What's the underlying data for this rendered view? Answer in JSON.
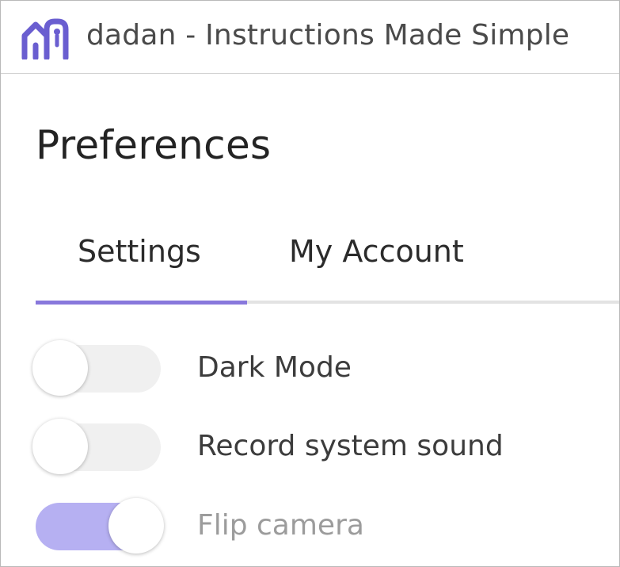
{
  "window": {
    "title": "dadan - Instructions Made Simple",
    "logo_icon": "dadan-logo-icon",
    "accent_color": "#8878dc"
  },
  "page": {
    "title": "Preferences"
  },
  "tabs": [
    {
      "label": "Settings",
      "active": true
    },
    {
      "label": "My Account",
      "active": false
    }
  ],
  "settings": [
    {
      "label": "Dark Mode",
      "enabled": false
    },
    {
      "label": "Record system sound",
      "enabled": false
    },
    {
      "label": "Flip camera",
      "enabled": true
    }
  ]
}
